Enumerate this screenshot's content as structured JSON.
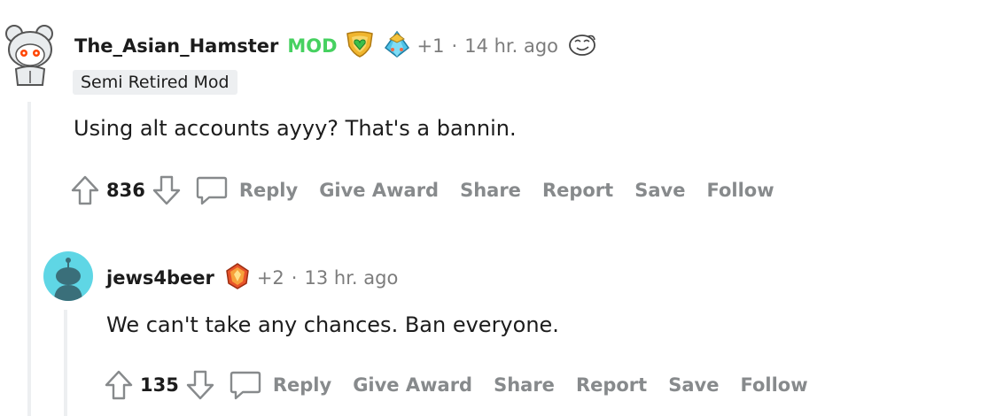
{
  "comments": [
    {
      "author": "The_Asian_Hamster",
      "mod_badge": "MOD",
      "mod_color": "#46d160",
      "awards": [
        "shield-heart-award",
        "diamond-hat-award"
      ],
      "award_count": "+1",
      "separator": "·",
      "time": "14 hr. ago",
      "trailing_emoji": "face-emoji",
      "flair": "Semi Retired Mod",
      "text": "Using alt accounts ayyy? That's a bannin.",
      "score": "836",
      "actions": {
        "reply": "Reply",
        "give_award": "Give Award",
        "share": "Share",
        "report": "Report",
        "save": "Save",
        "follow": "Follow"
      }
    },
    {
      "author": "jews4beer",
      "awards": [
        "orange-gem-award"
      ],
      "award_count": "+2",
      "separator": "·",
      "time": "13 hr. ago",
      "text": "We can't take any chances. Ban everyone.",
      "score": "135",
      "actions": {
        "reply": "Reply",
        "give_award": "Give Award",
        "share": "Share",
        "report": "Report",
        "save": "Save",
        "follow": "Follow"
      }
    }
  ],
  "colors": {
    "text": "#1c1c1c",
    "meta": "#7c7c7c",
    "action": "#878a8c",
    "thread_line": "#edeff1",
    "avatar2_bg": "#5fd6e5"
  }
}
